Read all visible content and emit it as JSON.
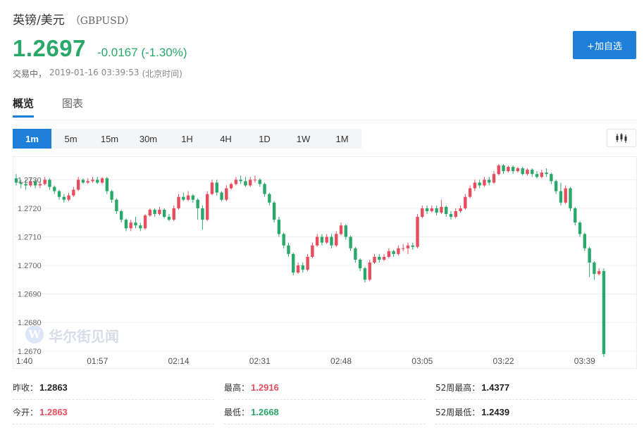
{
  "header": {
    "name": "英镑/美元",
    "code": "（GBPUSD）",
    "price": "1.2697",
    "change": "-0.0167 (-1.30%)",
    "status": "交易中，",
    "timestamp": "2019-01-16 03:39:53",
    "timezone": "(北京时间)",
    "add_watchlist_label": "+加自选"
  },
  "tabs": [
    {
      "label": "概览",
      "active": true
    },
    {
      "label": "图表",
      "active": false
    }
  ],
  "periods": [
    {
      "label": "1m",
      "active": true
    },
    {
      "label": "5m"
    },
    {
      "label": "15m"
    },
    {
      "label": "30m"
    },
    {
      "label": "1H"
    },
    {
      "label": "4H"
    },
    {
      "label": "1D"
    },
    {
      "label": "1W"
    },
    {
      "label": "1M"
    }
  ],
  "chart_type_icon": "candlestick-icon",
  "watermark": "华尔街见闻",
  "colors": {
    "up": "#e64d5e",
    "down": "#2aa86a",
    "accent": "#1e7fd9"
  },
  "chart_data": {
    "type": "candlestick",
    "title": "",
    "xlabel": "",
    "ylabel": "",
    "x_tick_labels": [
      "1:40",
      "01:57",
      "02:14",
      "02:31",
      "02:48",
      "03:05",
      "03:22",
      "03:39"
    ],
    "y_tick_labels": [
      "1.2670",
      "1.2680",
      "1.2690",
      "1.2700",
      "1.2710",
      "1.2720",
      "1.2730"
    ],
    "ylim": [
      1.2667,
      1.2736
    ],
    "grid": true,
    "points_per_label": 17,
    "candles": [
      [
        1.27305,
        1.2729,
        1.2732,
        1.2728
      ],
      [
        1.2729,
        1.27285,
        1.273,
        1.2727
      ],
      [
        1.27285,
        1.2728,
        1.273,
        1.27265
      ],
      [
        1.2728,
        1.27295,
        1.27305,
        1.27275
      ],
      [
        1.27295,
        1.2728,
        1.273,
        1.2727
      ],
      [
        1.2728,
        1.27285,
        1.27295,
        1.2727
      ],
      [
        1.27285,
        1.273,
        1.2731,
        1.2728
      ],
      [
        1.273,
        1.27275,
        1.27305,
        1.27265
      ],
      [
        1.27275,
        1.2726,
        1.2728,
        1.2725
      ],
      [
        1.2726,
        1.2724,
        1.27265,
        1.2723
      ],
      [
        1.2724,
        1.2723,
        1.2725,
        1.2722
      ],
      [
        1.2723,
        1.27245,
        1.27255,
        1.27225
      ],
      [
        1.27245,
        1.27265,
        1.27275,
        1.2724
      ],
      [
        1.27265,
        1.273,
        1.2731,
        1.2726
      ],
      [
        1.273,
        1.2729,
        1.27305,
        1.27285
      ],
      [
        1.2729,
        1.27295,
        1.27305,
        1.27285
      ],
      [
        1.27295,
        1.273,
        1.2731,
        1.2729
      ],
      [
        1.273,
        1.2729,
        1.2731,
        1.27285
      ],
      [
        1.2729,
        1.27305,
        1.2731,
        1.27285
      ],
      [
        1.27305,
        1.2726,
        1.2731,
        1.2725
      ],
      [
        1.2726,
        1.2723,
        1.27265,
        1.2722
      ],
      [
        1.2723,
        1.2719,
        1.27235,
        1.2718
      ],
      [
        1.2719,
        1.2716,
        1.27195,
        1.2715
      ],
      [
        1.2716,
        1.2713,
        1.27165,
        1.2712
      ],
      [
        1.2713,
        1.2715,
        1.2716,
        1.2712
      ],
      [
        1.2715,
        1.2714,
        1.2717,
        1.2713
      ],
      [
        1.2714,
        1.2713,
        1.2715,
        1.2712
      ],
      [
        1.2713,
        1.27175,
        1.2718,
        1.27125
      ],
      [
        1.27175,
        1.27195,
        1.272,
        1.2717
      ],
      [
        1.27195,
        1.2718,
        1.272,
        1.2717
      ],
      [
        1.2718,
        1.27195,
        1.27205,
        1.27175
      ],
      [
        1.27195,
        1.2717,
        1.272,
        1.27165
      ],
      [
        1.2717,
        1.2716,
        1.2718,
        1.27155
      ],
      [
        1.2716,
        1.272,
        1.2721,
        1.27155
      ],
      [
        1.272,
        1.2724,
        1.2725,
        1.27195
      ],
      [
        1.2724,
        1.2723,
        1.27255,
        1.27225
      ],
      [
        1.2723,
        1.27245,
        1.2726,
        1.27225
      ],
      [
        1.27245,
        1.2723,
        1.2725,
        1.2722
      ],
      [
        1.2723,
        1.272,
        1.27235,
        1.2716
      ],
      [
        1.272,
        1.2716,
        1.2721,
        1.27125
      ],
      [
        1.2716,
        1.2725,
        1.2726,
        1.27155
      ],
      [
        1.2725,
        1.2729,
        1.273,
        1.27245
      ],
      [
        1.2729,
        1.27255,
        1.273,
        1.27245
      ],
      [
        1.27255,
        1.2723,
        1.2726,
        1.27225
      ],
      [
        1.2723,
        1.2727,
        1.2728,
        1.27225
      ],
      [
        1.2727,
        1.27285,
        1.2729,
        1.27265
      ],
      [
        1.27285,
        1.273,
        1.2731,
        1.2728
      ],
      [
        1.273,
        1.27295,
        1.27315,
        1.27285
      ],
      [
        1.27295,
        1.2728,
        1.2731,
        1.27275
      ],
      [
        1.2728,
        1.273,
        1.2731,
        1.27275
      ],
      [
        1.273,
        1.273,
        1.27315,
        1.2729
      ],
      [
        1.273,
        1.27285,
        1.27305,
        1.27275
      ],
      [
        1.27285,
        1.2725,
        1.2729,
        1.2724
      ],
      [
        1.2725,
        1.2722,
        1.27255,
        1.2721
      ],
      [
        1.2722,
        1.2716,
        1.27225,
        1.2715
      ],
      [
        1.2716,
        1.2711,
        1.2717,
        1.271
      ],
      [
        1.2711,
        1.2707,
        1.27115,
        1.2706
      ],
      [
        1.2707,
        1.2704,
        1.2708,
        1.2703
      ],
      [
        1.2704,
        1.26975,
        1.27045,
        1.26965
      ],
      [
        1.26975,
        1.27,
        1.2701,
        1.2697
      ],
      [
        1.27,
        1.26985,
        1.2701,
        1.26975
      ],
      [
        1.26985,
        1.2703,
        1.2704,
        1.2698
      ],
      [
        1.2703,
        1.2707,
        1.2708,
        1.27025
      ],
      [
        1.2707,
        1.271,
        1.2711,
        1.27065
      ],
      [
        1.271,
        1.2708,
        1.2711,
        1.2707
      ],
      [
        1.2708,
        1.271,
        1.2711,
        1.27075
      ],
      [
        1.271,
        1.2707,
        1.2711,
        1.2706
      ],
      [
        1.2707,
        1.2711,
        1.2712,
        1.27065
      ],
      [
        1.2711,
        1.2714,
        1.2715,
        1.27105
      ],
      [
        1.2714,
        1.271,
        1.27145,
        1.2709
      ],
      [
        1.271,
        1.2706,
        1.27105,
        1.2705
      ],
      [
        1.2706,
        1.2702,
        1.27065,
        1.2701
      ],
      [
        1.2702,
        1.2699,
        1.27025,
        1.2698
      ],
      [
        1.2699,
        1.2695,
        1.26995,
        1.2694
      ],
      [
        1.2695,
        1.2701,
        1.2702,
        1.26945
      ],
      [
        1.2701,
        1.2703,
        1.2704,
        1.27005
      ],
      [
        1.2703,
        1.2702,
        1.2704,
        1.2701
      ],
      [
        1.2702,
        1.2703,
        1.2704,
        1.27015
      ],
      [
        1.2703,
        1.2705,
        1.2706,
        1.27025
      ],
      [
        1.2705,
        1.2704,
        1.27055,
        1.2703
      ],
      [
        1.2704,
        1.2706,
        1.2707,
        1.27035
      ],
      [
        1.2706,
        1.2706,
        1.27075,
        1.2705
      ],
      [
        1.2706,
        1.2707,
        1.2708,
        1.2704
      ],
      [
        1.2707,
        1.27065,
        1.2708,
        1.27055
      ],
      [
        1.27065,
        1.2717,
        1.2718,
        1.2706
      ],
      [
        1.2717,
        1.272,
        1.2721,
        1.27165
      ],
      [
        1.272,
        1.2719,
        1.2721,
        1.2718
      ],
      [
        1.2719,
        1.272,
        1.2721,
        1.27185
      ],
      [
        1.272,
        1.27185,
        1.2721,
        1.27175
      ],
      [
        1.27185,
        1.27205,
        1.2723,
        1.2718
      ],
      [
        1.27205,
        1.2718,
        1.2721,
        1.2717
      ],
      [
        1.2718,
        1.2717,
        1.2719,
        1.2716
      ],
      [
        1.2717,
        1.2719,
        1.272,
        1.27165
      ],
      [
        1.2719,
        1.272,
        1.2721,
        1.27185
      ],
      [
        1.272,
        1.2724,
        1.2725,
        1.27195
      ],
      [
        1.2724,
        1.2727,
        1.2728,
        1.27235
      ],
      [
        1.2727,
        1.2729,
        1.273,
        1.2726
      ],
      [
        1.2729,
        1.2728,
        1.273,
        1.2727
      ],
      [
        1.2728,
        1.273,
        1.2731,
        1.27275
      ],
      [
        1.273,
        1.2729,
        1.2731,
        1.2728
      ],
      [
        1.2729,
        1.2732,
        1.2733,
        1.27285
      ],
      [
        1.2732,
        1.2735,
        1.27355,
        1.27315
      ],
      [
        1.2735,
        1.2733,
        1.27355,
        1.2732
      ],
      [
        1.2733,
        1.27345,
        1.2735,
        1.27325
      ],
      [
        1.27345,
        1.2733,
        1.2735,
        1.2732
      ],
      [
        1.2733,
        1.2734,
        1.27345,
        1.27325
      ],
      [
        1.2734,
        1.2732,
        1.27345,
        1.27315
      ],
      [
        1.2732,
        1.27335,
        1.2734,
        1.27315
      ],
      [
        1.27335,
        1.2732,
        1.2734,
        1.2731
      ],
      [
        1.2732,
        1.2731,
        1.2733,
        1.27305
      ],
      [
        1.2731,
        1.27325,
        1.27335,
        1.27305
      ],
      [
        1.27325,
        1.2732,
        1.2734,
        1.2731
      ],
      [
        1.2732,
        1.27295,
        1.27325,
        1.27285
      ],
      [
        1.27295,
        1.2726,
        1.273,
        1.2725
      ],
      [
        1.2726,
        1.2722,
        1.2729,
        1.2721
      ],
      [
        1.2722,
        1.2727,
        1.2728,
        1.27215
      ],
      [
        1.2727,
        1.272,
        1.27275,
        1.2719
      ],
      [
        1.272,
        1.2715,
        1.27205,
        1.2714
      ],
      [
        1.2715,
        1.2711,
        1.27155,
        1.271
      ],
      [
        1.2711,
        1.2706,
        1.27115,
        1.2705
      ],
      [
        1.2706,
        1.2701,
        1.27065,
        1.2696
      ],
      [
        1.2701,
        1.2697,
        1.27015,
        1.2695
      ],
      [
        1.2697,
        1.2698,
        1.2699,
        1.26965
      ],
      [
        1.2698,
        1.2669,
        1.2699,
        1.2668
      ]
    ]
  },
  "stats": {
    "prev_close": {
      "label": "昨收：",
      "value": "1.2863"
    },
    "high": {
      "label": "最高：",
      "value": "1.2916"
    },
    "high_52w": {
      "label": "52周最高：",
      "value": "1.4377"
    },
    "open": {
      "label": "今开：",
      "value": "1.2863"
    },
    "low": {
      "label": "最低：",
      "value": "1.2668"
    },
    "low_52w": {
      "label": "52周最低：",
      "value": "1.2439"
    }
  }
}
